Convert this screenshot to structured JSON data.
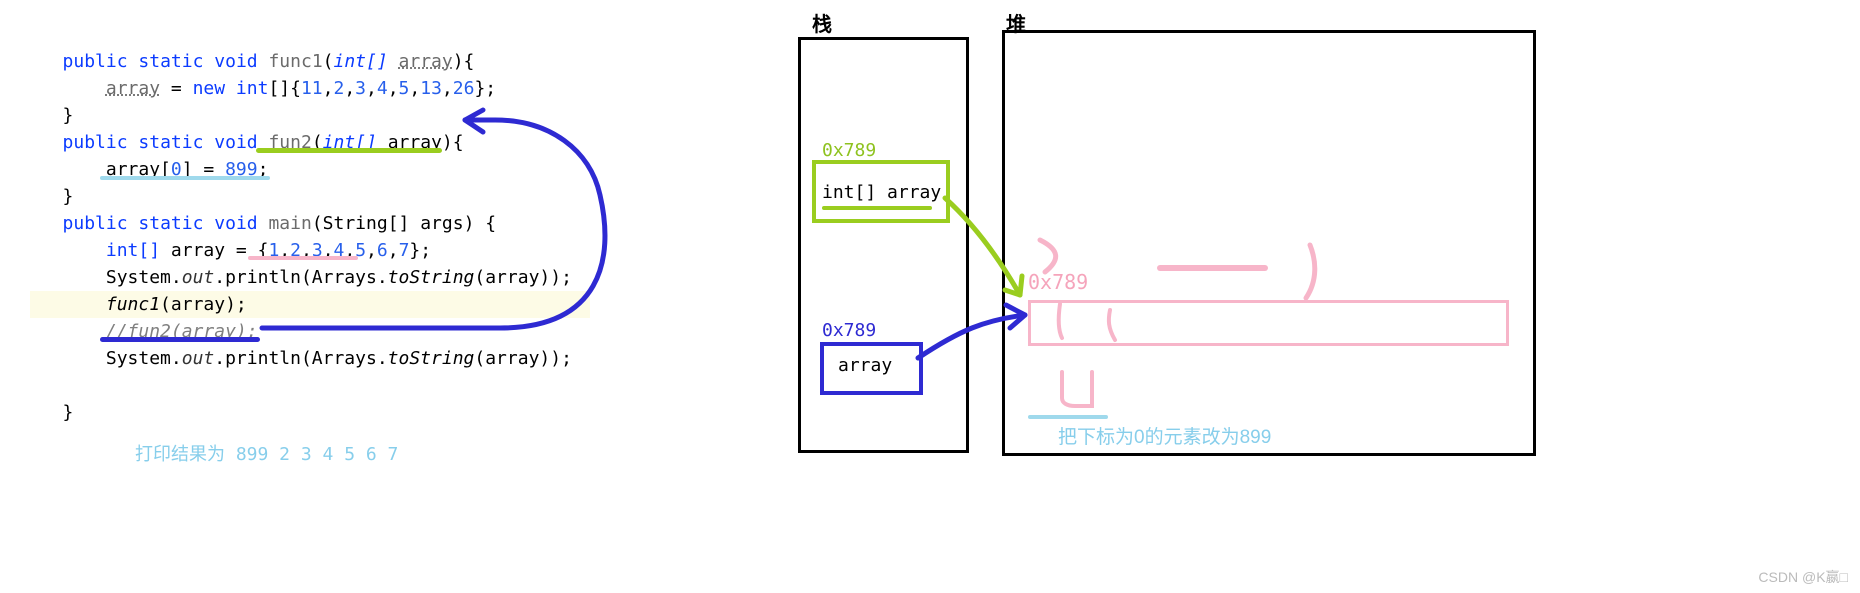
{
  "code": {
    "func1_sig_1": "public",
    "func1_sig_2": "static",
    "func1_sig_3": "void",
    "func1_name": "func1",
    "func1_param_t": "int[]",
    "func1_param_n": "array",
    "func1_body_array": "array",
    "func1_body_new": "new",
    "func1_body_type": "int",
    "func1_vals": [
      "11",
      "2",
      "3",
      "4",
      "5",
      "13",
      "26"
    ],
    "fun2_sig_1": "public",
    "fun2_sig_2": "static",
    "fun2_sig_3": "void",
    "fun2_name": "fun2",
    "fun2_param_t": "int[]",
    "fun2_param_n": "array",
    "fun2_body_lhs": "array",
    "fun2_body_idx": "0",
    "fun2_body_rhs": "899",
    "main_sig_1": "public",
    "main_sig_2": "static",
    "main_sig_3": "void",
    "main_name": "main",
    "main_param": "String[] args",
    "main_decl_t": "int[]",
    "main_decl_n": "array",
    "main_decl_vals": [
      "1",
      "2",
      "3",
      "4",
      "5",
      "6",
      "7"
    ],
    "main_sys": "System",
    "main_out": "out",
    "main_println": "println",
    "main_arrays": "Arrays",
    "main_tostring": "toString",
    "main_arg": "array",
    "main_call_func1": "func1",
    "main_call_func1_arg": "array",
    "main_comment": "//fun2(array);",
    "result_label": "打印结果为 899 2 3 4 5 6 7"
  },
  "diagram": {
    "stack_title": "栈",
    "heap_title": "堆",
    "addr_green": "0x789",
    "frame_green_text": "int[] array",
    "addr_blue": "0x789",
    "frame_blue_text": "array",
    "addr_pink": "0x789",
    "annotation_cyan": "把下标为0的元素改为899"
  },
  "watermark": "CSDN @K嬴□"
}
